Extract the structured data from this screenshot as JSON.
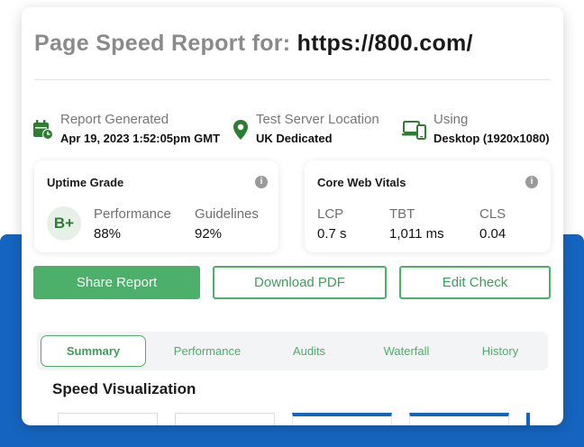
{
  "header": {
    "title_label": "Page Speed Report for:",
    "url": "https://800.com/"
  },
  "report_info": [
    {
      "label": "Report Generated",
      "value": "Apr 19, 2023 1:52:05pm GMT",
      "icon": "calendar-clock-icon"
    },
    {
      "label": "Test Server Location",
      "value": "UK Dedicated",
      "icon": "location-pin-icon"
    },
    {
      "label": "Using",
      "value": "Desktop (1920x1080)",
      "icon": "devices-icon"
    }
  ],
  "uptime": {
    "title": "Uptime Grade",
    "grade": "B+",
    "performance_label": "Performance",
    "performance_value": "88%",
    "guidelines_label": "Guidelines",
    "guidelines_value": "92%"
  },
  "core_web_vitals": {
    "title": "Core Web Vitals",
    "lcp_label": "LCP",
    "lcp_value": "0.7 s",
    "tbt_label": "TBT",
    "tbt_value": "1,011 ms",
    "cls_label": "CLS",
    "cls_value": "0.04"
  },
  "info_glyph": "i",
  "actions": {
    "share": "Share Report",
    "download": "Download PDF",
    "edit": "Edit Check"
  },
  "tabs": [
    "Summary",
    "Performance",
    "Audits",
    "Waterfall",
    "History"
  ],
  "active_tab": "Summary",
  "section_title": "Speed Visualization",
  "colors": {
    "accent_green": "#4caf6a",
    "brand_blue": "#1565c0"
  }
}
